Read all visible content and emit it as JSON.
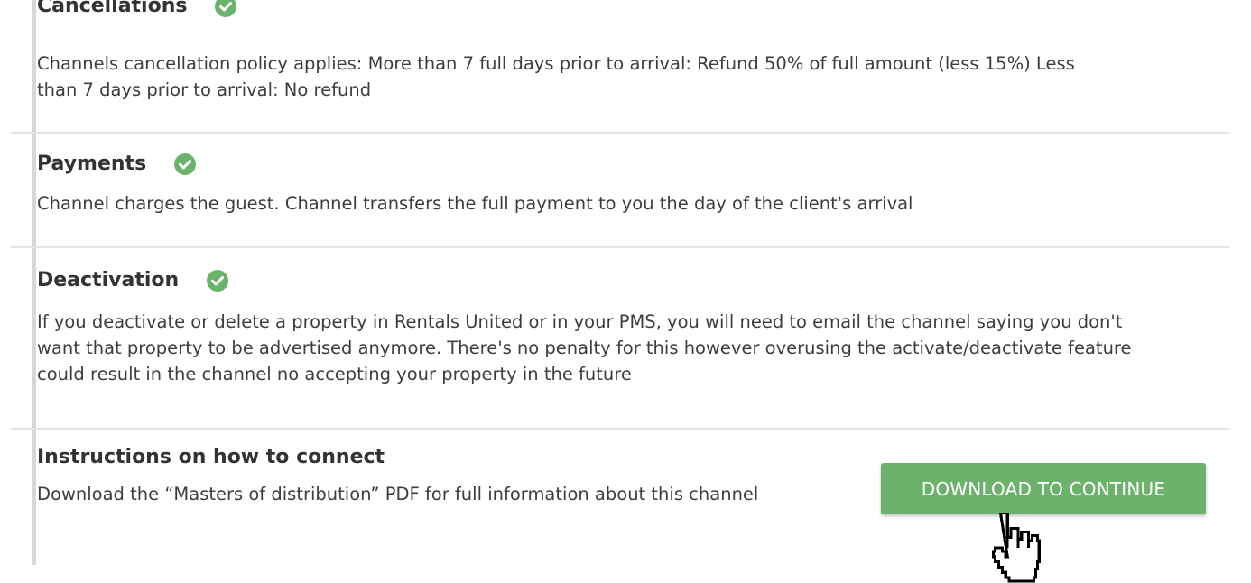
{
  "sections": {
    "cancellations": {
      "title": "Cancellations",
      "body": "Channels cancellation policy applies: More than 7 full days prior to arrival: Refund 50% of full amount (less 15%) Less than 7 days prior to arrival: No refund"
    },
    "payments": {
      "title": "Payments",
      "body": "Channel charges the guest. Channel transfers the full payment to you the day of the client's arrival"
    },
    "deactivation": {
      "title": "Deactivation",
      "body": "If you deactivate or delete a property in Rentals United or in your PMS, you will need to email the channel saying you don't want that property to be advertised anymore. There's no penalty for this however overusing the activate/deactivate feature could result in the channel no accepting your property in the future"
    },
    "instructions": {
      "title": "Instructions on how to connect",
      "body": "Download the “Masters of distribution” PDF for full information about this channel"
    }
  },
  "download_button": {
    "label": "DOWNLOAD TO CONTINUE"
  },
  "icons": {
    "check": "check-circle-icon",
    "cursor": "hand-pointer-icon"
  },
  "colors": {
    "accent_green": "#6db26c",
    "text": "#3d3d3d",
    "divider": "#e6e6e6"
  }
}
